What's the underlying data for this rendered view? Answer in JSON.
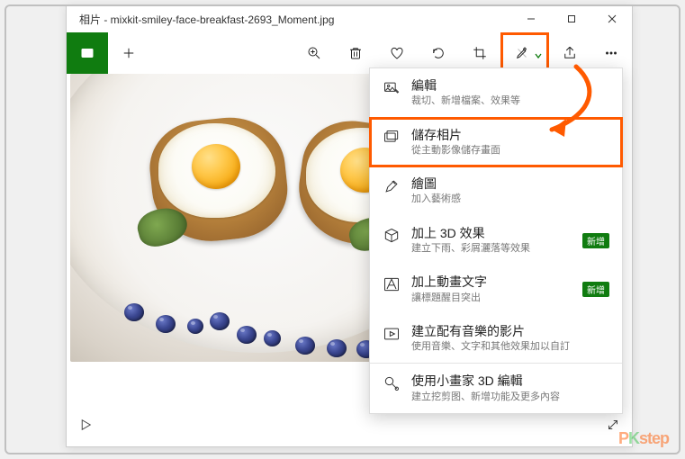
{
  "titlebar": {
    "title": "相片 - mixkit-smiley-face-breakfast-2693_Moment.jpg"
  },
  "toolbar": {
    "collection_icon": "image-collection-icon",
    "add_icon": "plus-icon",
    "zoom_icon": "zoom-in-icon",
    "delete_icon": "trash-icon",
    "favorite_icon": "heart-icon",
    "rotate_icon": "rotate-icon",
    "crop_icon": "crop-icon",
    "edit_icon": "edit-draw-icon",
    "share_icon": "share-icon",
    "more_icon": "more-icon"
  },
  "menu": {
    "items": [
      {
        "title": "編輯",
        "sub": "裁切、新增檔案、效果等"
      },
      {
        "title": "儲存相片",
        "sub": "從主動影像儲存畫面"
      },
      {
        "title": "繪圖",
        "sub": "加入藝術感"
      },
      {
        "title": "加上 3D 效果",
        "sub": "建立下雨、彩屑灑落等效果",
        "badge": "新增"
      },
      {
        "title": "加上動畫文字",
        "sub": "讓標題醒目突出",
        "badge": "新增"
      },
      {
        "title": "建立配有音樂的影片",
        "sub": "使用音樂、文字和其他效果加以自訂"
      },
      {
        "title": "使用小畫家 3D 編輯",
        "sub": "建立挖剪图、新增功能及更多內容"
      }
    ]
  },
  "watermark": "PKstep"
}
